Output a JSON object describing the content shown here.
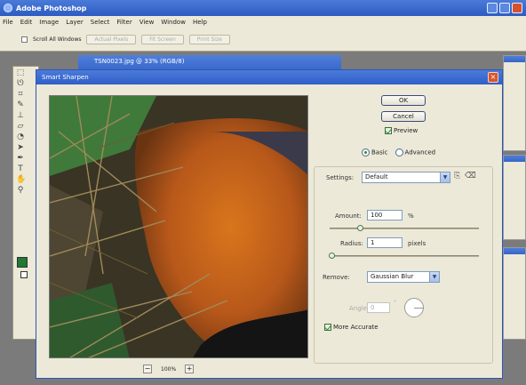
{
  "app": {
    "title": "Adobe Photoshop",
    "menu": [
      "File",
      "Edit",
      "Image",
      "Layer",
      "Select",
      "Filter",
      "View",
      "Window",
      "Help"
    ],
    "options": {
      "scroll_all_windows": "Scroll All Windows",
      "buttons": [
        "Actual Pixels",
        "Fit Screen",
        "Print Size"
      ]
    }
  },
  "document": {
    "title": "TSN0023.jpg @ 33% (RGB/8)"
  },
  "dialog": {
    "title": "Smart Sharpen",
    "ok": "OK",
    "cancel": "Cancel",
    "preview_label": "Preview",
    "preview_checked": true,
    "mode_basic": "Basic",
    "mode_advanced": "Advanced",
    "mode_selected": "Basic",
    "settings_label": "Settings:",
    "settings_value": "Default",
    "amount_label": "Amount:",
    "amount_value": "100",
    "amount_unit": "%",
    "radius_label": "Radius:",
    "radius_value": "1",
    "radius_unit": "pixels",
    "remove_label": "Remove:",
    "remove_value": "Gaussian Blur",
    "angle_label": "Angle:",
    "angle_value": "0",
    "more_accurate_label": "More Accurate",
    "more_accurate_checked": true,
    "zoom_value": "100%",
    "amount_fraction": 0.2,
    "radius_fraction": 0.01
  },
  "colors": {
    "foreground": "#1f7a32",
    "background": "#ffffff",
    "titlebar": "#2d5bc2",
    "dialog_bg": "#ece9d8"
  }
}
